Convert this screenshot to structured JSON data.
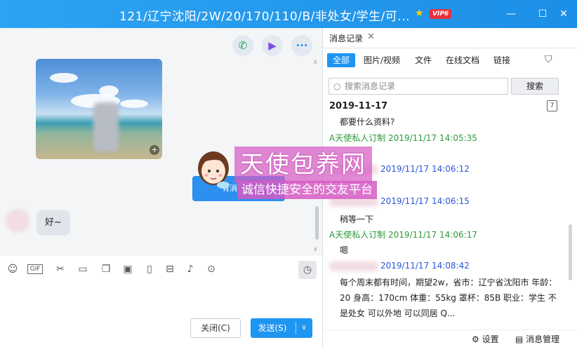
{
  "window": {
    "title": "121/辽宁沈阳/2W/20/170/110/B/非处女/学生/可...",
    "vip_badge": "VIP6",
    "controls": [
      "minimize",
      "maximize",
      "close"
    ]
  },
  "chat": {
    "call_icons": [
      "phone-icon",
      "video-icon",
      "more-icon"
    ],
    "image_message": {
      "kind": "beach-photo"
    },
    "text_message": "好~"
  },
  "toolbar": {
    "icons": [
      "emoji-icon",
      "gif-icon",
      "scissors-icon",
      "folder-icon",
      "sticker-icon",
      "image-icon",
      "shake-icon",
      "red-packet-icon",
      "music-icon",
      "more-icon"
    ],
    "history_icon": "clock-icon"
  },
  "composer": {
    "close_label": "关闭(C)",
    "send_label": "发送(S)"
  },
  "history_panel": {
    "tab_label": "消息记录",
    "filters": [
      "全部",
      "图片/视频",
      "文件",
      "在线文档",
      "链接"
    ],
    "search_placeholder": "搜索消息记录",
    "search_button": "搜索",
    "date": "2019-11-17",
    "calendar_icon_label": "7",
    "messages": [
      {
        "text": "都要什么资料?"
      },
      {
        "sender": "A天使私人订制 2019/11/17 14:05:35"
      },
      {
        "sender": "2019/11/17 14:06:12"
      },
      {
        "sender": "2019/11/17 14:06:15"
      },
      {
        "text": "稍等一下"
      },
      {
        "sender": "A天使私人订制 2019/11/17 14:06:17"
      },
      {
        "text": "嗯"
      },
      {
        "sender": "2019/11/17 14:08:42"
      }
    ],
    "long_message": "每个周末都有时间，期望2w，省市：辽宁省沈阳市 年龄：20 身高：170cm 体重：55kg 罩杯：85B 职业：学生 不是处女 可以外地 可以同居 Q...",
    "footer": {
      "settings": "设置",
      "manage": "消息管理"
    }
  },
  "watermark": {
    "title": "天使包养网",
    "subtitle": "诚信快捷安全的交友平台",
    "banner_text": "有消"
  },
  "colors": {
    "titlebar": "#2ea3f2",
    "accent": "#1f95f2",
    "sender_a": "#2a9a3a",
    "sender_b": "#2a56d8",
    "watermark": "#d65cc4"
  }
}
